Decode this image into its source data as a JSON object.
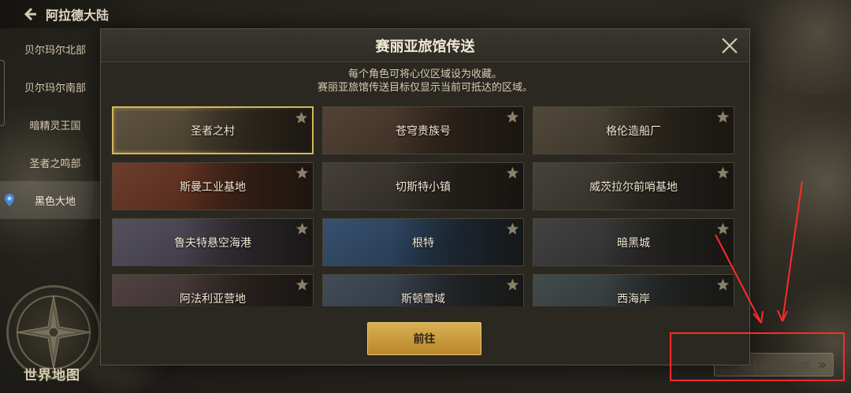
{
  "topbar": {
    "title": "阿拉德大陆"
  },
  "region_list": [
    {
      "label": "贝尔玛尔北部",
      "active": false
    },
    {
      "label": "贝尔玛尔南部",
      "active": false
    },
    {
      "label": "暗精灵王国",
      "active": false
    },
    {
      "label": "圣者之鸣部",
      "active": false
    },
    {
      "label": "黑色大地",
      "active": true
    }
  ],
  "world_map_label": "世界地图",
  "goto_inn_label": "前往赛丽亚旅馆",
  "modal": {
    "title": "赛丽亚旅馆传送",
    "desc_line1": "每个角色可将心仪区域设为收藏。",
    "desc_line2": "赛丽亚旅馆传送目标仅显示当前可抵达的区域。",
    "go_label": "前往"
  },
  "destinations": [
    {
      "name": "圣者之村",
      "selected": true,
      "tint": "#5a4e38"
    },
    {
      "name": "苍穹贵族号",
      "selected": false,
      "tint": "#4e3a2c"
    },
    {
      "name": "格伦造船厂",
      "selected": false,
      "tint": "#4a4232"
    },
    {
      "name": "斯曼工业基地",
      "selected": false,
      "tint": "#6a3422"
    },
    {
      "name": "切斯特小镇",
      "selected": false,
      "tint": "#3c3630"
    },
    {
      "name": "威茨拉尔前哨基地",
      "selected": false,
      "tint": "#3e3a32"
    },
    {
      "name": "鲁夫特悬空海港",
      "selected": false,
      "tint": "#4e4a58"
    },
    {
      "name": "根特",
      "selected": false,
      "tint": "#2e4a6a"
    },
    {
      "name": "暗黑城",
      "selected": false,
      "tint": "#3a3a3a"
    },
    {
      "name": "阿法利亚营地",
      "selected": false,
      "tint": "#4a3a3a"
    },
    {
      "name": "斯顿雪域",
      "selected": false,
      "tint": "#3a4452"
    },
    {
      "name": "西海岸",
      "selected": false,
      "tint": "#3a4446"
    }
  ],
  "colors": {
    "accent_gold": "#d7b65c",
    "annotation_red": "#ff2a2a"
  },
  "icons": {
    "back": "back-arrow-icon",
    "close": "close-icon",
    "star": "star-icon",
    "forward": "double-chevron-right-icon"
  }
}
